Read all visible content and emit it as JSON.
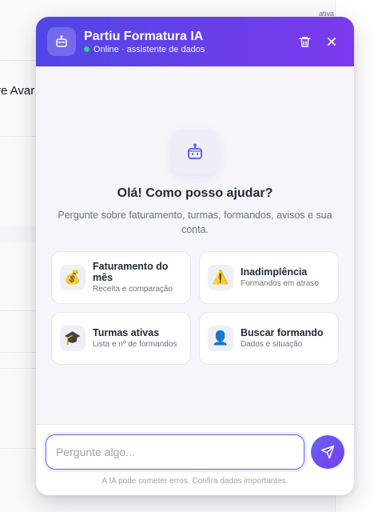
{
  "background": {
    "status_fragment": "ativa",
    "row_fragment": "re Avar"
  },
  "chat": {
    "header": {
      "title": "Partiu Formatura IA",
      "status": "Online · assistente de dados",
      "bot_icon": "robot-icon",
      "clear_icon": "trash-icon",
      "close_icon": "close-icon",
      "status_color": "#34d399"
    },
    "welcome": {
      "title": "Olá! Como posso ajudar?",
      "subtitle": "Pergunte sobre faturamento, turmas, formandos, avisos e sua conta."
    },
    "suggestions": [
      {
        "icon": "💰",
        "icon_name": "money-bag-icon",
        "title": "Faturamento do mês",
        "desc": "Receita e comparação"
      },
      {
        "icon": "⚠️",
        "icon_name": "warning-icon",
        "title": "Inadimplência",
        "desc": "Formandos em atraso"
      },
      {
        "icon": "🎓",
        "icon_name": "graduation-cap-icon",
        "title": "Turmas ativas",
        "desc": "Lista e nº de formandos"
      },
      {
        "icon": "👤",
        "icon_name": "person-icon",
        "title": "Buscar formando",
        "desc": "Dados e situação"
      }
    ],
    "input": {
      "placeholder": "Pergunte algo...",
      "value": ""
    },
    "send_icon": "send-icon",
    "disclaimer": "A IA pode cometer erros. Confira dados importantes.",
    "colors": {
      "accent_start": "#4f46e5",
      "accent_end": "#7c3aed"
    }
  }
}
